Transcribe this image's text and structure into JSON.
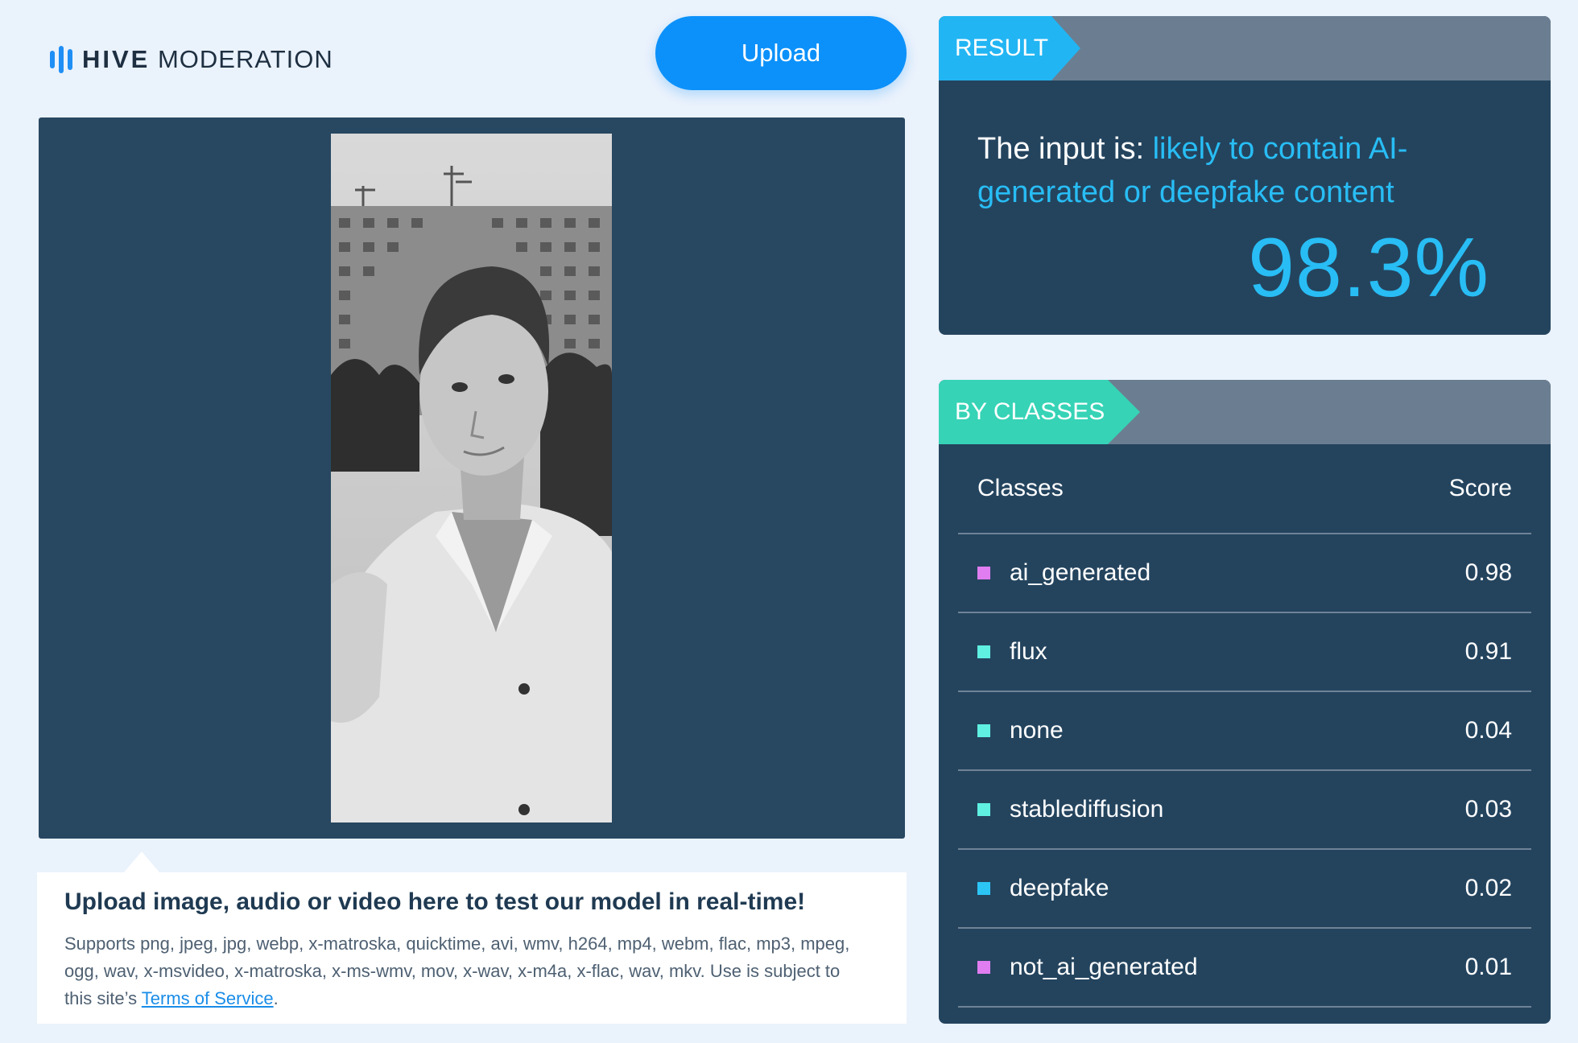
{
  "brand": {
    "name_bold": "HIVE",
    "name_light": "MODERATION",
    "accent": "#1f8ff5"
  },
  "header": {
    "upload_label": "Upload"
  },
  "preview": {
    "panel_color": "#284761",
    "info_title": "Upload image, audio or video here to test our model in real-time!",
    "info_supports": "Supports png, jpeg, jpg, webp, x-matroska, quicktime, avi, wmv, h264, mp4, webm, flac, mp3, mpeg, ogg, wav, x-msvideo, x-matroska, x-ms-wmv, mov, x-wav, x-m4a, x-flac, wav, mkv. Use is subject to this site’s ",
    "terms_link": "Terms of Service",
    "info_end": "."
  },
  "result": {
    "tag": "RESULT",
    "prefix": "The input is: ",
    "verdict": "likely to contain AI-generated or deepfake content",
    "score": "98.3%",
    "color": "#28bdf5"
  },
  "classes": {
    "tag": "BY CLASSES",
    "col_class": "Classes",
    "col_score": "Score",
    "rows": [
      {
        "name": "ai_generated",
        "score": "0.98",
        "color": "#e07df0"
      },
      {
        "name": "flux",
        "score": "0.91",
        "color": "#5ff0e2"
      },
      {
        "name": "none",
        "score": "0.04",
        "color": "#5ff0e2"
      },
      {
        "name": "stablediffusion",
        "score": "0.03",
        "color": "#5ff0e2"
      },
      {
        "name": "deepfake",
        "score": "0.02",
        "color": "#2cc6f6"
      },
      {
        "name": "not_ai_generated",
        "score": "0.01",
        "color": "#e07df0"
      }
    ]
  }
}
